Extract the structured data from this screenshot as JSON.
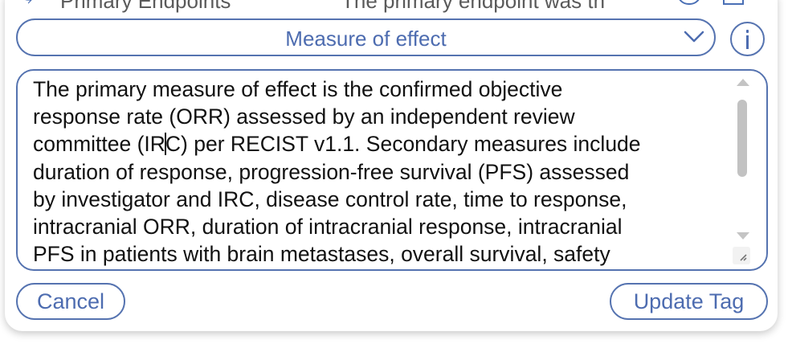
{
  "peek": {
    "label": "Primary Endpoints",
    "value": "The primary endpoint was th"
  },
  "select": {
    "value": "Measure of effect"
  },
  "textarea": {
    "lines": [
      "The primary measure of effect is the confirmed objective",
      "response rate (ORR) assessed by an independent review",
      "committee (IR",
      "C) per RECIST v1.1. Secondary measures include",
      "duration of response, progression-free survival (PFS) assessed",
      "by investigator and IRC, disease control rate, time to response,",
      "intracranial ORR, duration of intracranial response, intracranial",
      "PFS in patients with brain metastases, overall survival, safety"
    ]
  },
  "buttons": {
    "cancel": "Cancel",
    "update": "Update Tag"
  },
  "colors": {
    "accent": "#5573b0",
    "text": "#111111",
    "scrollbar": "#c2c2c2"
  },
  "icons": {
    "dropdown": "chevron-down-icon",
    "info": "info-icon",
    "resize": "resize-grip-icon"
  }
}
